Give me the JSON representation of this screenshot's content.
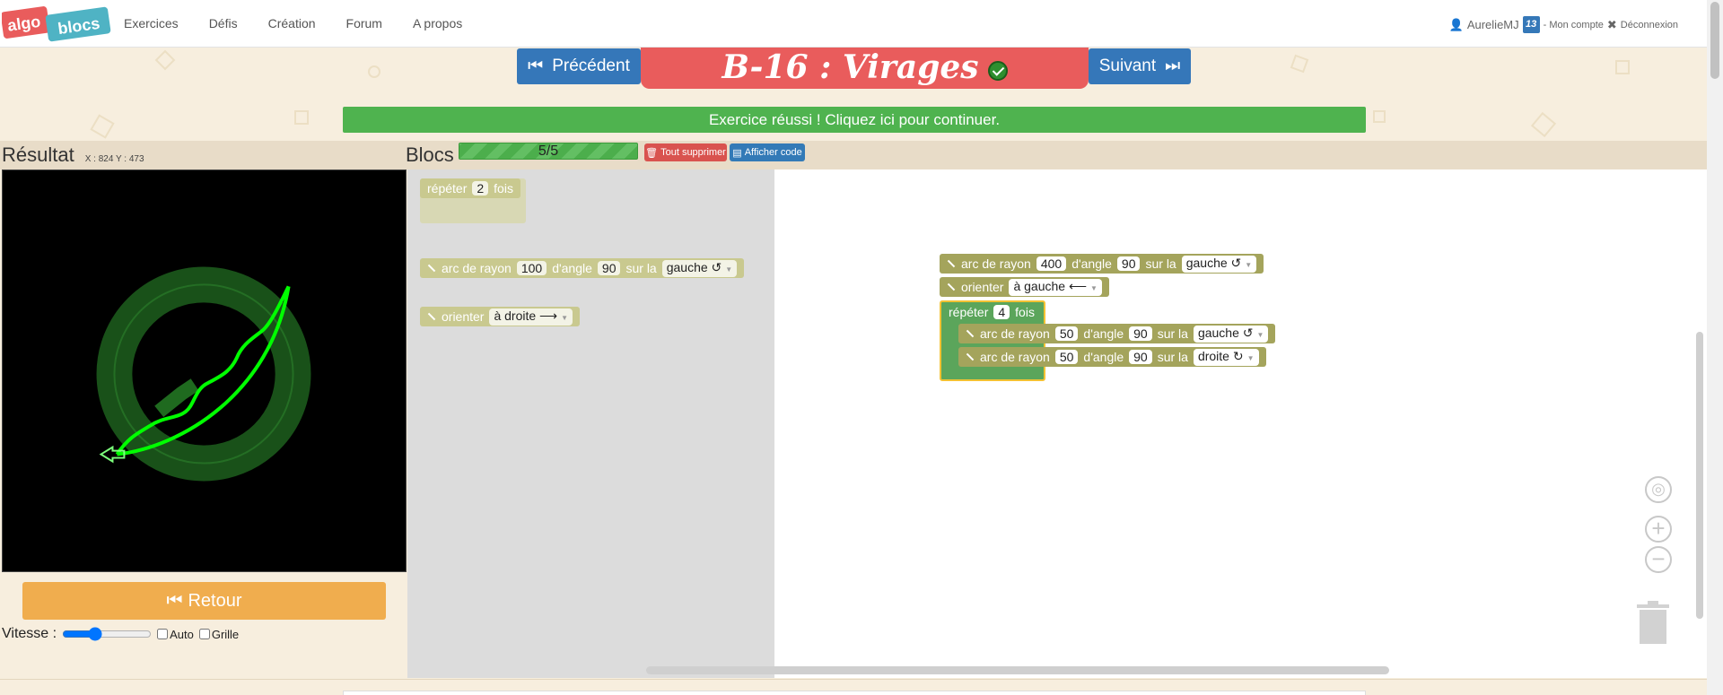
{
  "nav": {
    "logo_top": "algo",
    "logo_bottom": "blocs",
    "items": [
      "Exercices",
      "Défis",
      "Création",
      "Forum",
      "A propos"
    ]
  },
  "user": {
    "name": "AurelieMJ",
    "badge": "13",
    "account": "- Mon compte",
    "logout": "Déconnexion"
  },
  "header": {
    "prev_label": "Précédent",
    "next_label": "Suivant",
    "title": "B-16 : Virages",
    "success_message": "Exercice réussi ! Cliquez ici pour continuer."
  },
  "result": {
    "title": "Résultat",
    "coords": "X : 824 Y : 473",
    "retour_label": "Retour",
    "speed_label": "Vitesse :",
    "speed_value": 0.35,
    "auto_label": "Auto",
    "grid_label": "Grille"
  },
  "blocs": {
    "title": "Blocs",
    "progress": "5/5",
    "progress_value": 1.0,
    "delete_all_label": "Tout supprimer",
    "show_code_label": "Afficher code"
  },
  "toolbox": {
    "repeat": {
      "label": "répéter",
      "count": "2",
      "suffix": "fois"
    },
    "arc": {
      "label": "arc de rayon",
      "radius": "100",
      "angle_label": "d'angle",
      "angle": "90",
      "side_label": "sur la",
      "side": "gauche ↺"
    },
    "orient": {
      "label": "orienter",
      "direction": "à droite ⟶"
    }
  },
  "program": {
    "arc1": {
      "label": "arc de rayon",
      "radius": "400",
      "angle_label": "d'angle",
      "angle": "90",
      "side_label": "sur la",
      "side": "gauche ↺"
    },
    "orient": {
      "label": "orienter",
      "direction": "à gauche ⟵"
    },
    "repeat": {
      "label": "répéter",
      "count": "4",
      "suffix": "fois"
    },
    "arc2": {
      "label": "arc de rayon",
      "radius": "50",
      "angle_label": "d'angle",
      "angle": "90",
      "side_label": "sur la",
      "side": "gauche ↺"
    },
    "arc3": {
      "label": "arc de rayon",
      "radius": "50",
      "angle_label": "d'angle",
      "angle": "90",
      "side_label": "sur la",
      "side": "droite ↻"
    }
  },
  "colors": {
    "nav_blue": "#3577b9",
    "title_red": "#e95c5c",
    "success_green": "#4fb34f",
    "block_olive": "#a4a45c",
    "repeat_green": "#5ba55b",
    "retour_orange": "#f0ad4e",
    "trace_green": "#00ff00"
  },
  "icons": [
    "user-icon",
    "close-icon",
    "step-backward-icon",
    "step-forward-icon",
    "check-circle-icon",
    "trash-icon",
    "code-icon",
    "fast-backward-icon",
    "pen-icon",
    "target-icon",
    "zoom-in-icon",
    "zoom-out-icon",
    "turtle-arrow-icon"
  ]
}
